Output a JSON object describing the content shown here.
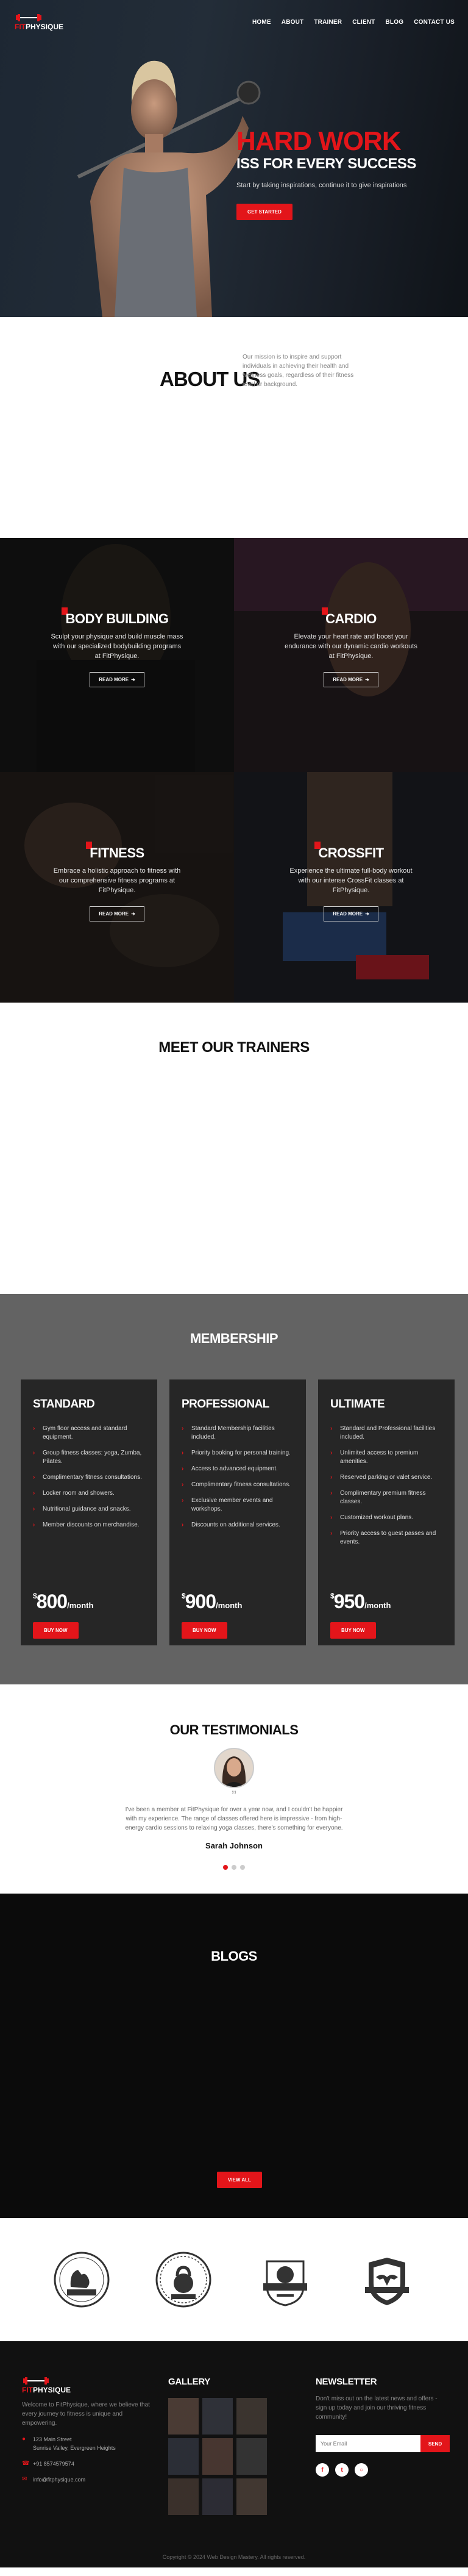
{
  "brand": {
    "logo_prefix": "FIT",
    "logo_suffix": "PHYSIQUE"
  },
  "nav": {
    "items": [
      "HOME",
      "ABOUT",
      "TRAINER",
      "CLIENT",
      "BLOG",
      "CONTACT US"
    ]
  },
  "hero": {
    "title": "HARD WORK",
    "subtitle": "ISS FOR EVERY SUCCESS",
    "text": "Start by taking inspirations, continue it to give inspirations",
    "button": "GET STARTED"
  },
  "about": {
    "heading": "ABOUT US",
    "text": "Our mission is to inspire and support individuals in achieving their health and wellness goals, regardless of their fitness level or background."
  },
  "programs": [
    {
      "title": "BODY BUILDING",
      "text": "Sculpt your physique and build muscle mass with our specialized bodybuilding programs at FitPhysique.",
      "button": "READ MORE"
    },
    {
      "title": "CARDIO",
      "text": "Elevate your heart rate and boost your endurance with our dynamic cardio workouts at FitPhysique.",
      "button": "READ MORE"
    },
    {
      "title": "FITNESS",
      "text": "Embrace a holistic approach to fitness with our comprehensive fitness programs at FitPhysique.",
      "button": "READ MORE"
    },
    {
      "title": "CROSSFIT",
      "text": "Experience the ultimate full-body workout with our intense CrossFit classes at FitPhysique.",
      "button": "READ MORE"
    }
  ],
  "trainers": {
    "heading": "MEET OUR TRAINERS"
  },
  "membership": {
    "heading": "MEMBERSHIP",
    "plans": [
      {
        "name": "STANDARD",
        "features": [
          "Gym floor access and standard equipment.",
          "Group fitness classes: yoga, Zumba, Pilates.",
          "Complimentary fitness consultations.",
          "Locker room and showers.",
          "Nutritional guidance and snacks.",
          "Member discounts on merchandise."
        ],
        "currency": "$",
        "price": "800",
        "period": "/month",
        "button": "BUY NOW"
      },
      {
        "name": "PROFESSIONAL",
        "features": [
          "Standard Membership facilities included.",
          "Priority booking for personal training.",
          "Access to advanced equipment.",
          "Complimentary fitness consultations.",
          "Exclusive member events and workshops.",
          "Discounts on additional services."
        ],
        "currency": "$",
        "price": "900",
        "period": "/month",
        "button": "BUY NOW"
      },
      {
        "name": "ULTIMATE",
        "features": [
          "Standard and Professional facilities included.",
          "Unlimited access to premium amenities.",
          "Reserved parking or valet service.",
          "Complimentary premium fitness classes.",
          "Customized workout plans.",
          "Priority access to guest passes and events."
        ],
        "currency": "$",
        "price": "950",
        "period": "/month",
        "button": "BUY NOW"
      }
    ]
  },
  "testimonials": {
    "heading": "OUR TESTIMONIALS",
    "quote_mark": "”",
    "text": "I've been a member at FitPhysique for over a year now, and I couldn't be happier with my experience. The range of classes offered here is impressive - from high-energy cardio sessions to relaxing yoga classes, there's something for everyone.",
    "author": "Sarah Johnson"
  },
  "blogs": {
    "heading": "BLOGS",
    "button": "VIEW ALL"
  },
  "partners": [
    "crest-badge-flexing-arm",
    "crest-badge-kettlebell",
    "crest-badge-fitness-center-dumbbell",
    "crest-badge-eagle-shield"
  ],
  "footer": {
    "about_text": "Welcome to FitPhysique, where we believe that every journey to fitness is unique and empowering.",
    "address": "123 Main Street\nSunrise Valley, Evergreen Heights",
    "phone": "+91 8574579574",
    "email": "info@fitphysique.com",
    "gallery_heading": "GALLERY",
    "newsletter_heading": "NEWSLETTER",
    "newsletter_text": "Don't miss out on the latest news and offers - sign up today and join our thriving fitness community!",
    "email_placeholder": "Your Email",
    "subscribe": "SEND",
    "copyright": "Copyright © 2024 Web Design Mastery. All rights reserved."
  },
  "colors": {
    "accent": "#e3151a",
    "dark": "#111111",
    "membership_bg": "#636363",
    "card_bg": "#262626"
  }
}
